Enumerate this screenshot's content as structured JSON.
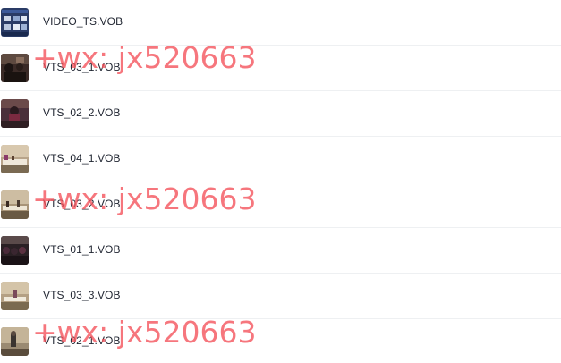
{
  "files": [
    {
      "name": "VIDEO_TS.VOB",
      "icon": "dvd-menu-thumbnail-icon"
    },
    {
      "name": "VTS_03_1.VOB",
      "icon": "video-thumbnail-icon"
    },
    {
      "name": "VTS_02_2.VOB",
      "icon": "video-thumbnail-icon"
    },
    {
      "name": "VTS_04_1.VOB",
      "icon": "video-thumbnail-icon"
    },
    {
      "name": "VTS_03_2.VOB",
      "icon": "video-thumbnail-icon"
    },
    {
      "name": "VTS_01_1.VOB",
      "icon": "video-thumbnail-icon"
    },
    {
      "name": "VTS_03_3.VOB",
      "icon": "video-thumbnail-icon"
    },
    {
      "name": "VTS_02_1.VOB",
      "icon": "video-thumbnail-icon"
    }
  ],
  "watermark": {
    "text": "+wx: jx520663",
    "color": "#f45058"
  },
  "colors": {
    "text": "#1f2430",
    "divider": "#eef0f2"
  }
}
